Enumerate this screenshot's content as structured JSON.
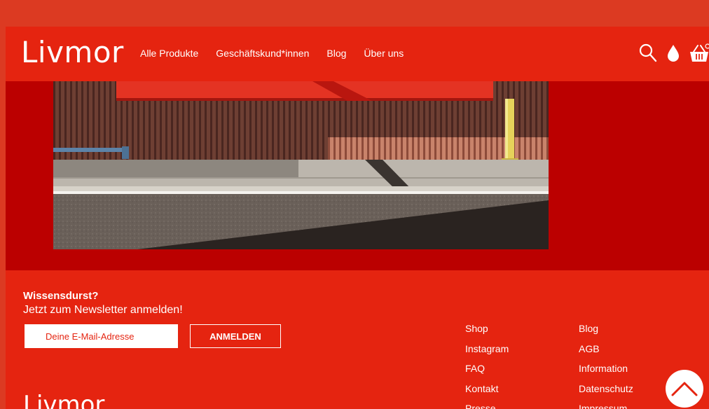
{
  "brand": {
    "name": "Livmor"
  },
  "nav": {
    "items": [
      {
        "label": "Alle Produkte"
      },
      {
        "label": "Geschäftskund*innen"
      },
      {
        "label": "Blog"
      },
      {
        "label": "Über uns"
      }
    ]
  },
  "icons": {
    "search": "search-icon",
    "drop": "drop-icon",
    "cart": "basket-icon",
    "scroll_top": "chevron-up-icon"
  },
  "colors": {
    "brand_red": "#e52410",
    "hero_red": "#bb0000",
    "outer": "#dc3a22"
  },
  "newsletter": {
    "title": "Wissensdurst?",
    "subtitle": "Jetzt zum Newsletter anmelden!",
    "placeholder": "Deine E-Mail-Adresse",
    "button": "ANMELDEN"
  },
  "footer": {
    "col1": [
      {
        "label": "Shop"
      },
      {
        "label": "Instagram"
      },
      {
        "label": "FAQ"
      },
      {
        "label": "Kontakt"
      },
      {
        "label": "Presse"
      }
    ],
    "col2": [
      {
        "label": "Blog"
      },
      {
        "label": "AGB"
      },
      {
        "label": "Information"
      },
      {
        "label": "Datenschutz"
      },
      {
        "label": "Impressum"
      }
    ]
  }
}
